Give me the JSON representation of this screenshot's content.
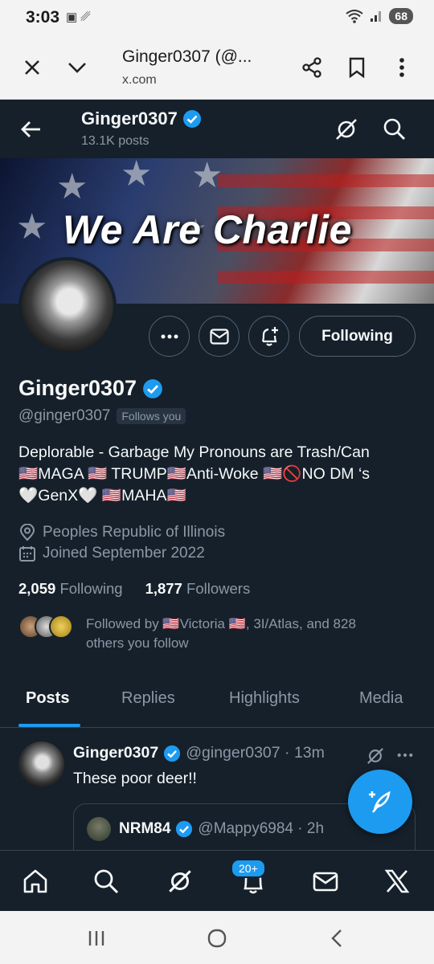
{
  "status_bar": {
    "time": "3:03",
    "battery": "68"
  },
  "browser": {
    "page_title": "Ginger0307 (@...",
    "domain": "x.com"
  },
  "header": {
    "name": "Ginger0307",
    "posts_count": "13.1K posts"
  },
  "banner": {
    "headline": "We Are Charlie"
  },
  "profile": {
    "follow_state": "Following",
    "display_name": "Ginger0307",
    "handle": "@ginger0307",
    "follows_you": "Follows you",
    "bio_line1": "Deplorable - Garbage My Pronouns are Trash/Can",
    "bio_line2": "🇺🇸MAGA 🇺🇸 TRUMP🇺🇸Anti-Woke 🇺🇸🚫NO DM ‘s",
    "bio_line3": "🤍GenX🤍 🇺🇸MAHA🇺🇸",
    "location": "Peoples Republic of Illinois",
    "joined": "Joined September 2022",
    "following_count": "2,059",
    "following_label": "Following",
    "followers_count": "1,877",
    "followers_label": "Followers",
    "followed_by_line1": "Followed by 🇺🇸Victoria 🇺🇸, 3I/Atlas, and 828",
    "followed_by_line2": "others you follow"
  },
  "tabs": [
    "Posts",
    "Replies",
    "Highlights",
    "Media"
  ],
  "tweet": {
    "author": "Ginger0307",
    "handle_time": "@ginger0307 · 13m",
    "text": "These poor deer!!",
    "quote_author": "NRM84",
    "quote_handle_time": "@Mappy6984 · 2h"
  },
  "bottom_nav": {
    "notifications_badge": "20+"
  },
  "colors": {
    "background": "#15202b",
    "accent": "#1d9bf0",
    "muted": "#8b98a5",
    "border": "#38444d"
  }
}
